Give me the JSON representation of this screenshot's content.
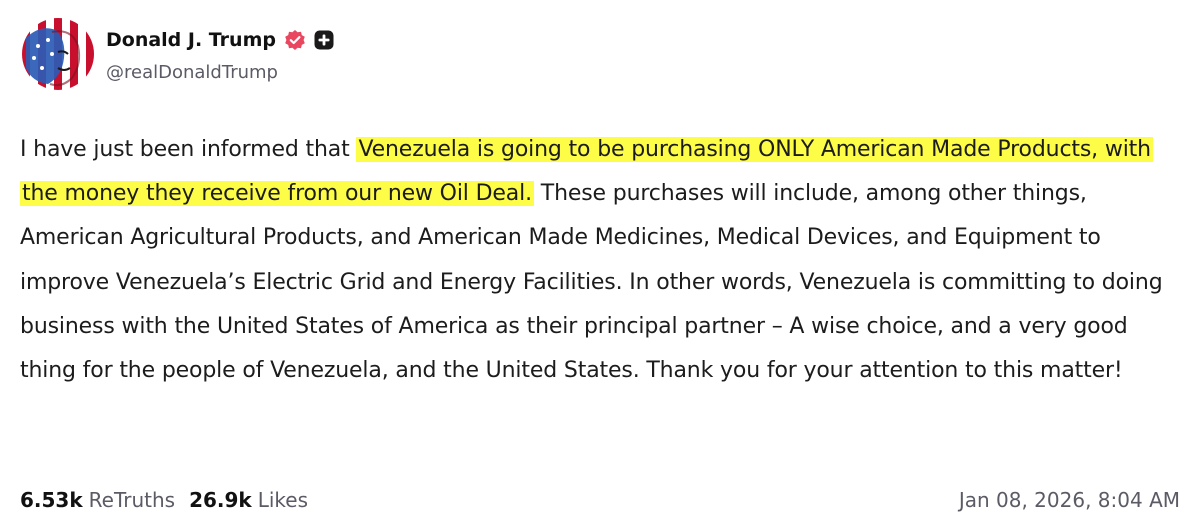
{
  "author": {
    "display_name": "Donald J. Trump",
    "handle": "@realDonaldTrump",
    "avatar_icon": "avatar-flag-portrait",
    "verified_icon": "verified-badge-icon",
    "plus_icon": "plus-badge-icon"
  },
  "post": {
    "text_before": "I have just been informed that ",
    "text_highlight": "Venezuela is going to be purchasing ONLY American Made Products, with the money they receive from our new Oil Deal.",
    "text_after": " These purchases will include, among other things, American Agricultural Products, and American Made Medicines, Medical Devices, and Equipment to improve Venezuela’s Electric Grid and Energy Facilities. In other words, Venezuela is committing to doing business with the United States of America as their principal partner – A wise choice, and a very good thing for the people of Venezuela, and the United States. Thank you for your attention to this matter!",
    "highlight_color": "#fdfc47"
  },
  "stats": {
    "retruths_count": "6.53k",
    "retruths_label": "ReTruths",
    "likes_count": "26.9k",
    "likes_label": "Likes"
  },
  "timestamp": "Jan 08, 2026, 8:04 AM",
  "colors": {
    "verified": "#e8475f",
    "text": "#1c1c1c",
    "muted": "#5b5b66"
  }
}
